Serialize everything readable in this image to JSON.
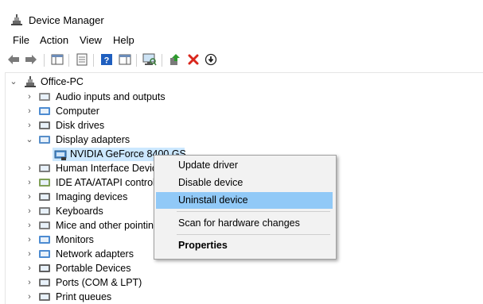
{
  "window": {
    "title": "Device Manager"
  },
  "menu": [
    "File",
    "Action",
    "View",
    "Help"
  ],
  "toolbar": {
    "buttons": [
      "back-icon",
      "forward-icon",
      "show-hide-console-tree-icon",
      "properties-icon",
      "help-icon",
      "show-action-pane-icon",
      "scan-hardware-icon",
      "update-driver-icon",
      "uninstall-icon",
      "disable-device-icon"
    ]
  },
  "tree": {
    "root": "Office-PC",
    "categories": [
      {
        "label": "Audio inputs and outputs",
        "icon": "speaker-icon"
      },
      {
        "label": "Computer",
        "icon": "computer-icon"
      },
      {
        "label": "Disk drives",
        "icon": "disk-drive-icon"
      },
      {
        "label": "Display adapters",
        "icon": "display-adapter-icon",
        "expanded": true
      },
      {
        "label": "Human Interface Devic",
        "icon": "hid-icon"
      },
      {
        "label": "IDE ATA/ATAPI control",
        "icon": "ide-controller-icon"
      },
      {
        "label": "Imaging devices",
        "icon": "camera-icon"
      },
      {
        "label": "Keyboards",
        "icon": "keyboard-icon"
      },
      {
        "label": "Mice and other pointin",
        "icon": "mouse-icon"
      },
      {
        "label": "Monitors",
        "icon": "monitor-icon"
      },
      {
        "label": "Network adapters",
        "icon": "network-adapter-icon"
      },
      {
        "label": "Portable Devices",
        "icon": "portable-device-icon"
      },
      {
        "label": "Ports (COM & LPT)",
        "icon": "port-icon"
      },
      {
        "label": "Print queues",
        "icon": "printer-icon"
      }
    ],
    "selected_device": "NVIDIA GeForce 8400 GS"
  },
  "context_menu": {
    "items": [
      "Update driver",
      "Disable device",
      "Uninstall device",
      "Scan for hardware changes",
      "Properties"
    ],
    "highlighted": "Uninstall device"
  },
  "colors": {
    "selection": "#cce8ff",
    "menu_highlight": "#91c9f7",
    "delete_red": "#d9261c",
    "help_blue": "#1f5fbf"
  }
}
